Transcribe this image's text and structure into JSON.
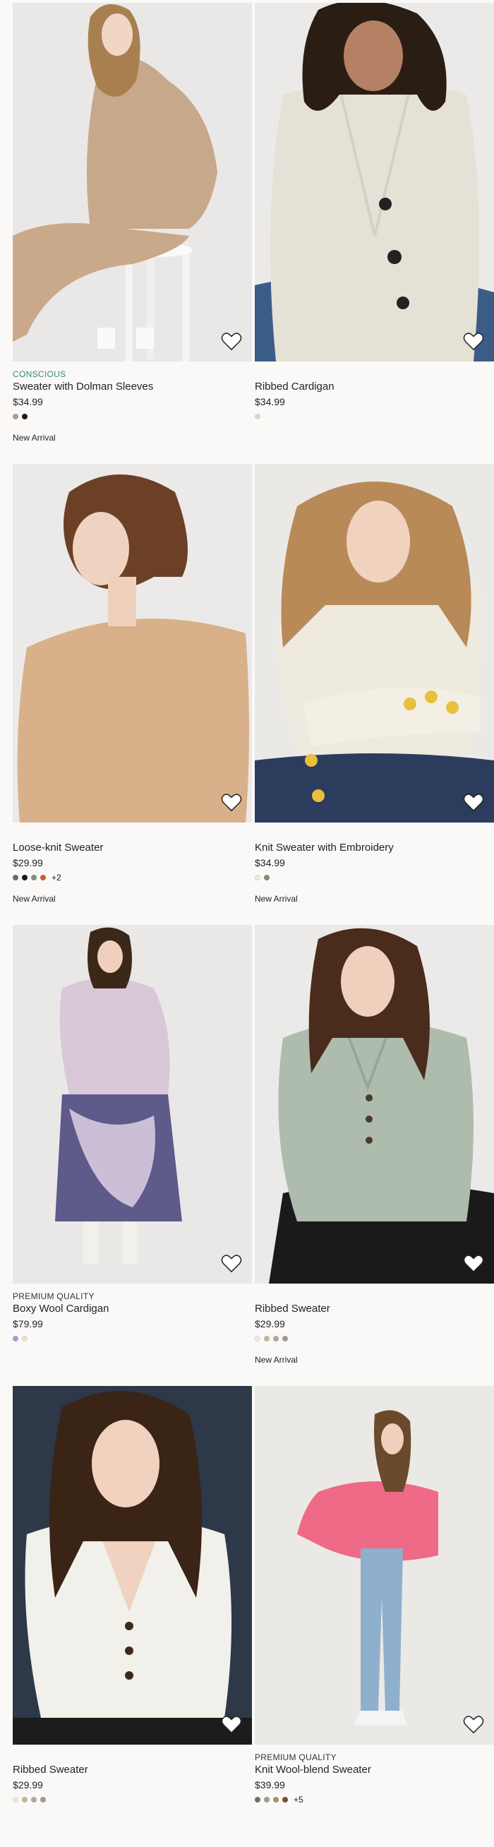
{
  "products": [
    {
      "badge": "CONSCIOUS",
      "badge_type": "conscious",
      "title": "Sweater with Dolman Sleeves",
      "price": "$34.99",
      "swatches": [
        "#b49a80",
        "#1c1c1c"
      ],
      "more": "",
      "tag": "New Arrival",
      "photo": "scene-1"
    },
    {
      "badge": "",
      "badge_type": "",
      "title": "Ribbed Cardigan",
      "price": "$34.99",
      "swatches": [
        "#d8d5d0"
      ],
      "more": "",
      "tag": "",
      "photo": "scene-2"
    },
    {
      "badge": "",
      "badge_type": "",
      "title": "Loose-knit Sweater",
      "price": "$29.99",
      "swatches": [
        "#6a6a6a",
        "#1c1c1c",
        "#888888",
        "#c2602e"
      ],
      "more": "+2",
      "tag": "New Arrival",
      "photo": "scene-3"
    },
    {
      "badge": "",
      "badge_type": "",
      "title": "Knit Sweater with Embroidery",
      "price": "$34.99",
      "swatches": [
        "#efeade",
        "#8a8a74"
      ],
      "more": "",
      "tag": "New Arrival",
      "photo": "scene-4"
    },
    {
      "badge": "PREMIUM QUALITY",
      "badge_type": "premium",
      "title": "Boxy Wool Cardigan",
      "price": "$79.99",
      "swatches": [
        "#a89ad0",
        "#e8e2cc"
      ],
      "more": "",
      "tag": "",
      "photo": "scene-5"
    },
    {
      "badge": "",
      "badge_type": "",
      "title": "Ribbed Sweater",
      "price": "$29.99",
      "swatches": [
        "#efece4",
        "#c8b490",
        "#b0a898",
        "#9a9a98"
      ],
      "more": "",
      "tag": "New Arrival",
      "photo": "scene-6"
    },
    {
      "badge": "",
      "badge_type": "",
      "title": "Ribbed Sweater",
      "price": "$29.99",
      "swatches": [
        "#efe9dc",
        "#c8b490",
        "#b0a898",
        "#9a9a98"
      ],
      "more": "",
      "tag": "",
      "photo": "scene-7"
    },
    {
      "badge": "PREMIUM QUALITY",
      "badge_type": "premium",
      "title": "Knit Wool-blend Sweater",
      "price": "$39.99",
      "swatches": [
        "#707060",
        "#9a9a98",
        "#a89060",
        "#7a5030"
      ],
      "more": "+5",
      "tag": "",
      "photo": "scene-8"
    }
  ]
}
